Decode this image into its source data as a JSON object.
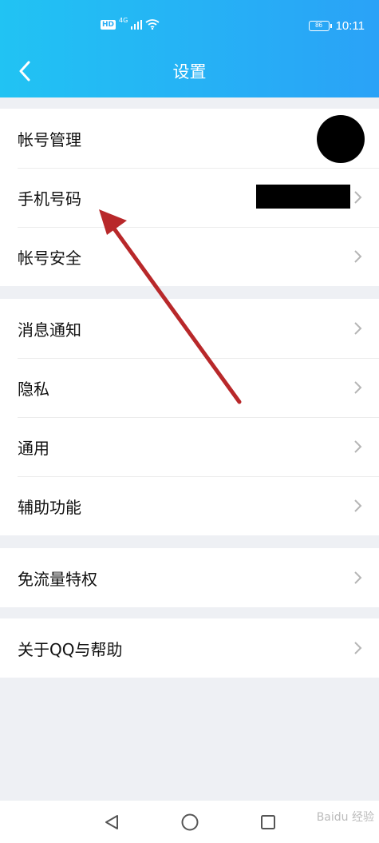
{
  "status_bar": {
    "hd_badge": "HD",
    "network": "4G",
    "battery": "86",
    "time": "10:11"
  },
  "nav": {
    "title": "设置",
    "back_icon": "chevron-left-icon"
  },
  "groups": [
    {
      "items": [
        {
          "label": "帐号管理",
          "trailing": "avatar"
        },
        {
          "label": "手机号码",
          "trailing": "redacted-phone"
        },
        {
          "label": "帐号安全",
          "trailing": "chevron"
        }
      ]
    },
    {
      "items": [
        {
          "label": "消息通知"
        },
        {
          "label": "隐私"
        },
        {
          "label": "通用"
        },
        {
          "label": "辅助功能"
        }
      ]
    },
    {
      "items": [
        {
          "label": "免流量特权"
        }
      ]
    },
    {
      "items": [
        {
          "label": "关于QQ与帮助"
        }
      ]
    }
  ],
  "system_nav": [
    "back-triangle-icon",
    "home-circle-icon",
    "recents-square-icon"
  ],
  "watermark": "Baidu 经验",
  "colors": {
    "header_start": "#21c3f3",
    "header_end": "#2aa2f7",
    "annotation_arrow": "#b8282a"
  }
}
